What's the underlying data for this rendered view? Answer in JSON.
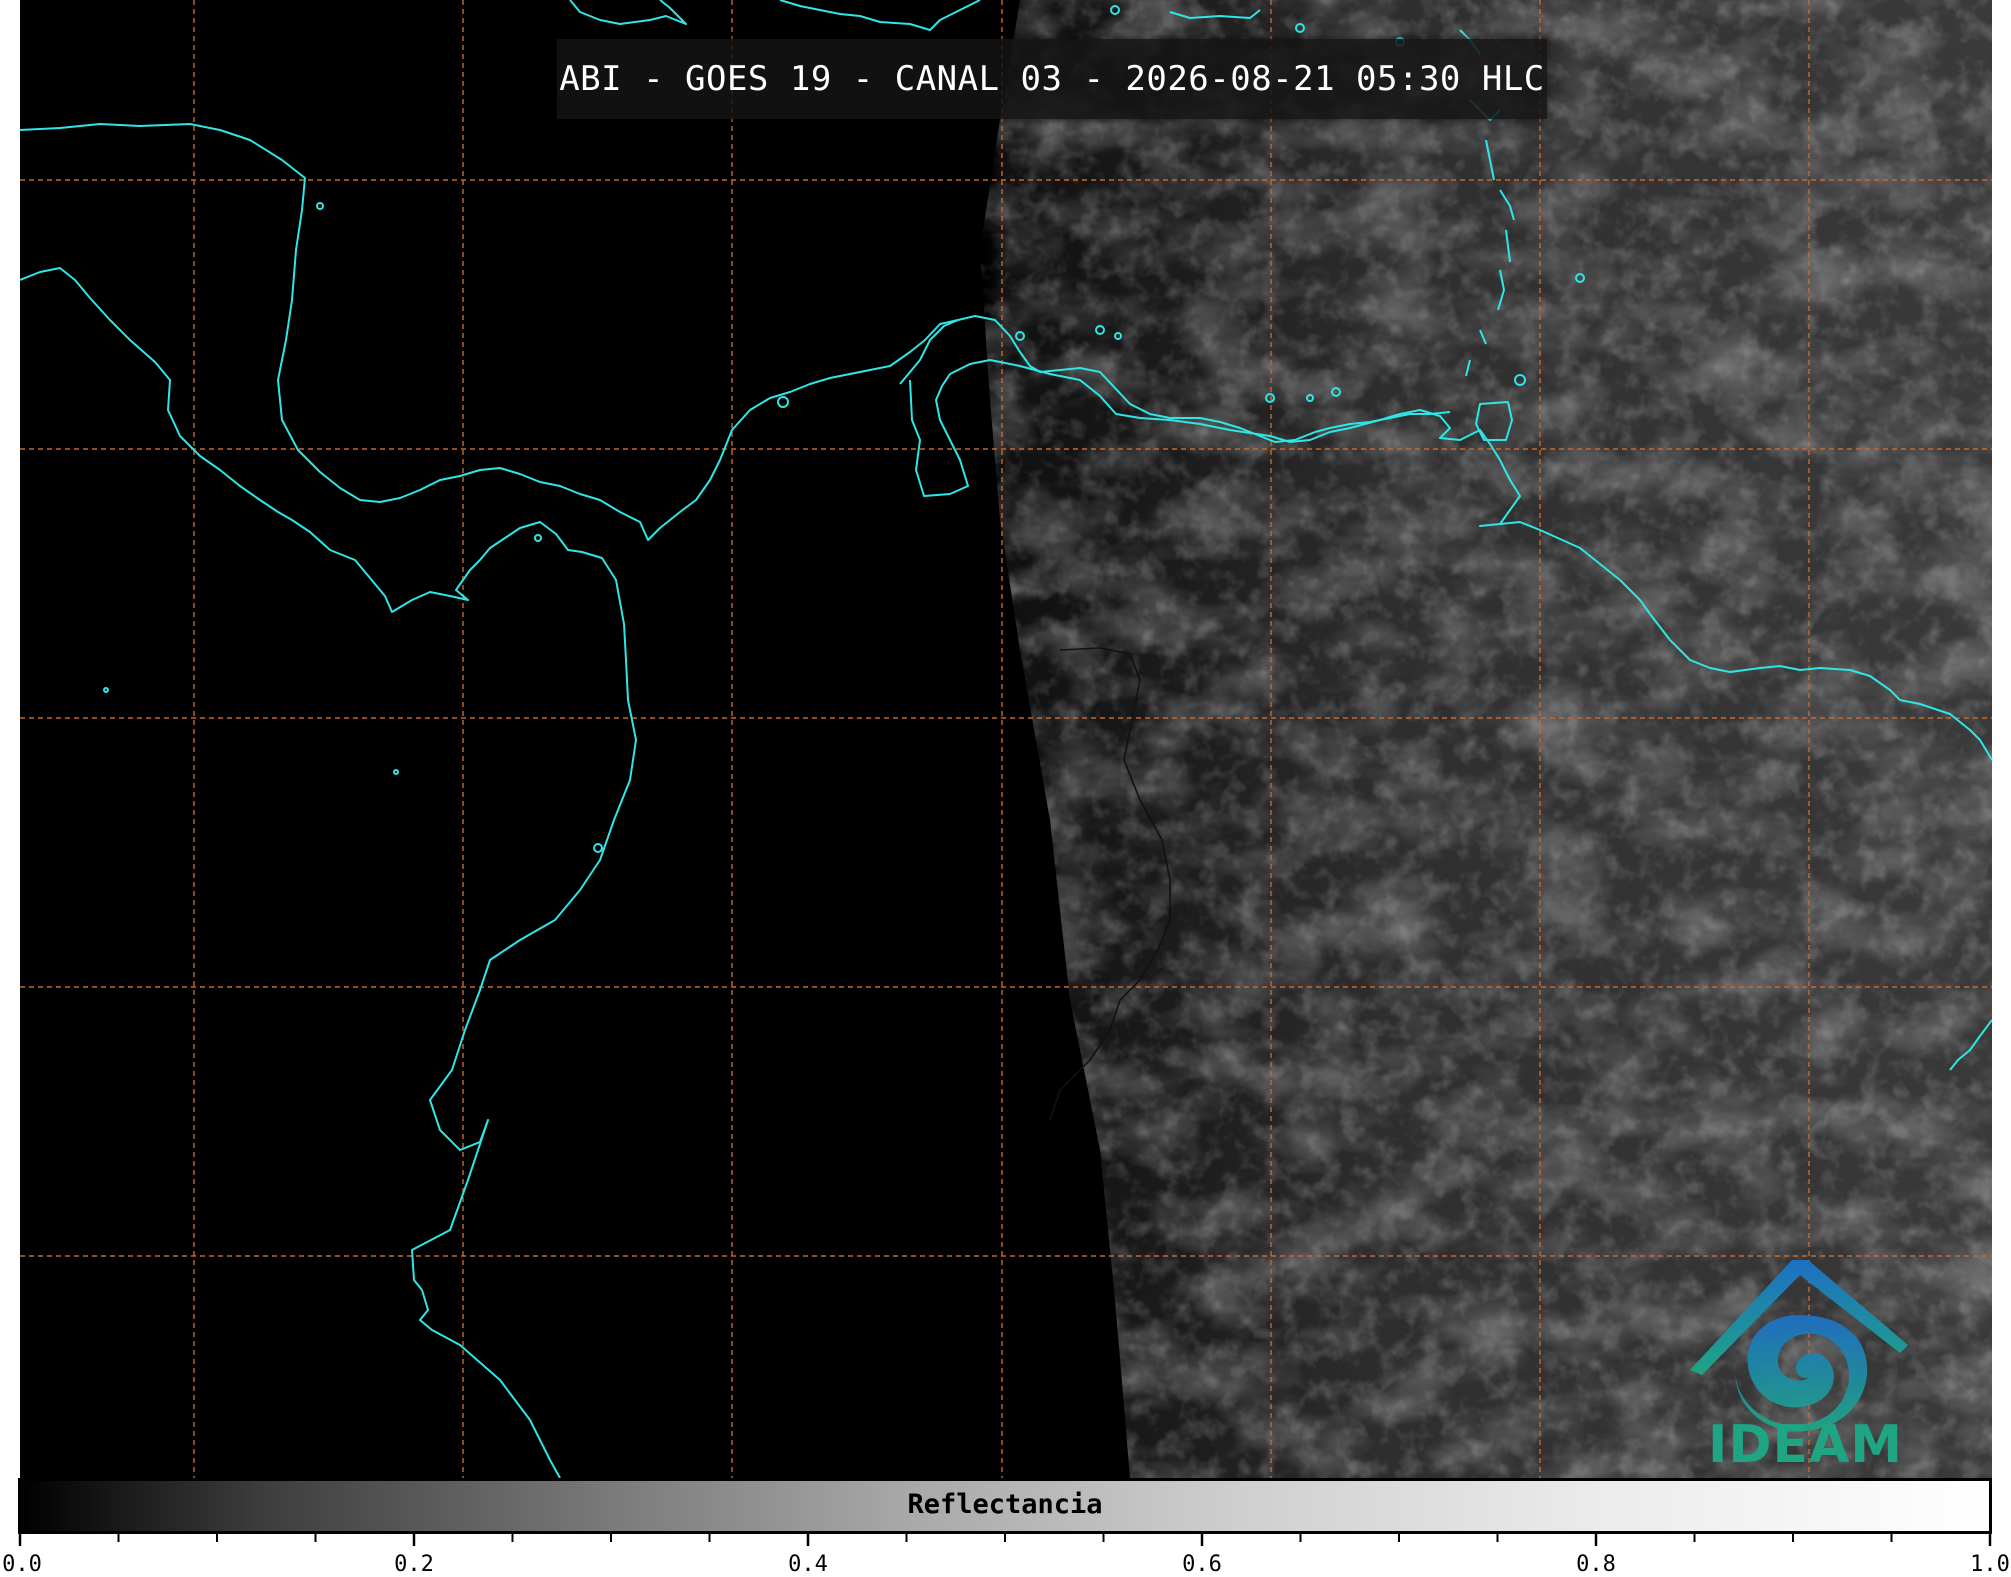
{
  "title": "ABI - GOES 19 - CANAL 03 - 2026-08-21 05:30 HLC",
  "logo": {
    "text": "IDEAM",
    "icon": "ideam-logo-icon"
  },
  "colorbar": {
    "label": "Reflectancia",
    "ticks": [
      {
        "value": 0.0,
        "label": "0.0"
      },
      {
        "value": 0.2,
        "label": "0.2"
      },
      {
        "value": 0.4,
        "label": "0.4"
      },
      {
        "value": 0.6,
        "label": "0.6"
      },
      {
        "value": 0.8,
        "label": "0.8"
      },
      {
        "value": 1.0,
        "label": "1.0"
      }
    ],
    "range": [
      0.0,
      1.0
    ]
  },
  "colors": {
    "coastline": "#2ee6e6",
    "gridlines": "#c8692a",
    "background": "#000000",
    "logo": "#1fa583"
  }
}
